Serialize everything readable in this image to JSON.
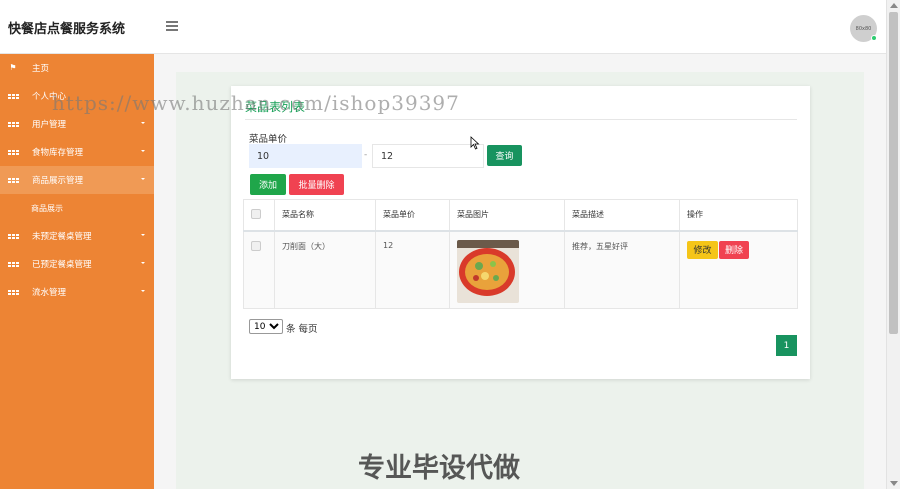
{
  "app": {
    "title": "快餐店点餐服务系统",
    "avatar_text": "80x80"
  },
  "sidebar": {
    "items": [
      {
        "label": "主页",
        "icon": "flag-icon"
      },
      {
        "label": "个人中心",
        "icon": "grid-icon"
      },
      {
        "label": "用户管理",
        "icon": "grid-icon",
        "expandable": true
      },
      {
        "label": "食物库存管理",
        "icon": "grid-icon",
        "expandable": true
      },
      {
        "label": "商品展示管理",
        "icon": "grid-icon",
        "expandable": true,
        "active": true
      },
      {
        "label": "商品展示",
        "sub": true
      },
      {
        "label": "未预定餐桌管理",
        "icon": "grid-icon",
        "expandable": true
      },
      {
        "label": "已预定餐桌管理",
        "icon": "grid-icon",
        "expandable": true
      },
      {
        "label": "流水管理",
        "icon": "grid-icon",
        "expandable": true
      }
    ]
  },
  "page": {
    "card_title": "菜品表列表",
    "filter": {
      "label": "菜品单价",
      "min_value": "10",
      "range_separator": "-",
      "max_value": "12",
      "query_label": "查询"
    },
    "actions": {
      "add_label": "添加",
      "batch_delete_label": "批量删除"
    },
    "table": {
      "columns": [
        "菜品名称",
        "菜品单价",
        "菜品图片",
        "菜品描述",
        "操作"
      ],
      "rows": [
        {
          "name": "刀削面（大）",
          "price": "12",
          "image": "dish-photo",
          "description": "推荐，五星好评",
          "edit_label": "修改",
          "delete_label": "删除"
        }
      ]
    },
    "pagination": {
      "page_size": "10",
      "page_size_options": [
        "10"
      ],
      "page_size_suffix": "条 每页",
      "current_page": "1"
    }
  },
  "overlays": {
    "watermark": "https://www.huzhan.com/ishop39397",
    "bottom_ad": "专业毕设代做"
  },
  "colors": {
    "sidebar": "#ed8434",
    "primary_green": "#18935f",
    "danger": "#f04251",
    "warning": "#f5c518",
    "add_green": "#1fa64a"
  }
}
